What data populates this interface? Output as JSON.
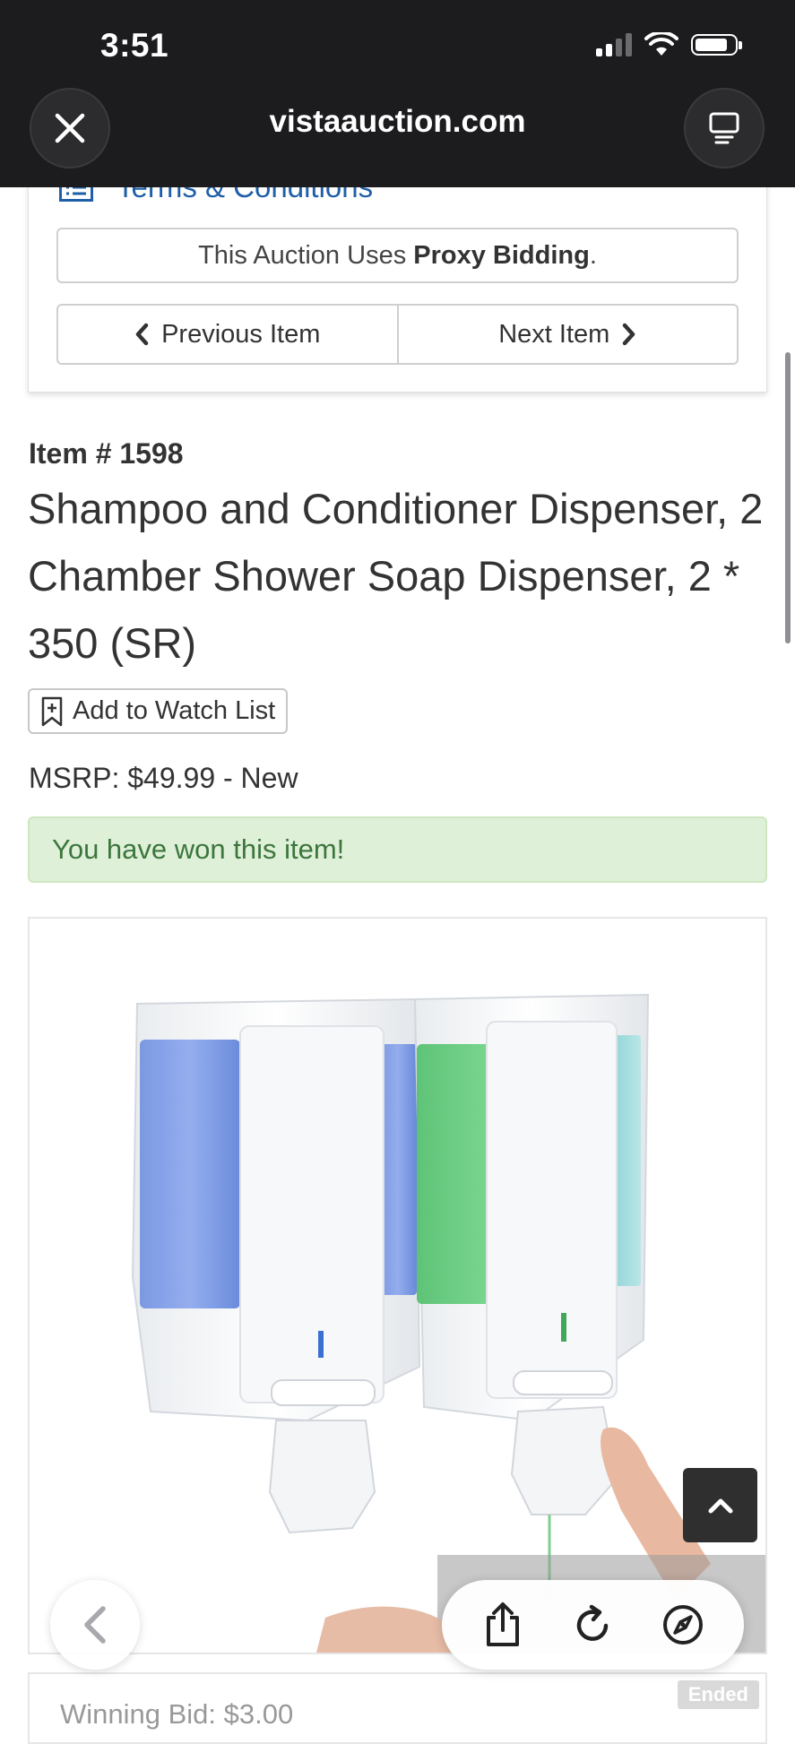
{
  "status_bar": {
    "time": "3:51"
  },
  "browser": {
    "url": "vistaauction.com"
  },
  "card": {
    "terms_label": "Terms & Conditions",
    "proxy_prefix": "This Auction Uses ",
    "proxy_bold": "Proxy Bidding",
    "proxy_suffix": ".",
    "prev_label": "Previous Item",
    "next_label": "Next Item"
  },
  "item": {
    "number": "Item # 1598",
    "title": "Shampoo and Conditioner Dispenser, 2 Chamber Shower Soap Dispenser, 2 * 350 (SR)",
    "watch_label": "Add to Watch List",
    "msrp": "MSRP: $49.99 - New",
    "won_message": "You have won this item!",
    "winning_bid": "Winning Bid: $3.00",
    "status_badge": "Ended"
  },
  "colors": {
    "link": "#1f5fa8",
    "success_bg": "#dff0d8",
    "success_text": "#3c763d",
    "chrome": "#1c1c1e"
  },
  "icons": [
    "close-icon",
    "reader-mode-icon",
    "list-icon",
    "chevron-left-icon",
    "chevron-right-icon",
    "bookmark-plus-icon",
    "chevron-up-icon",
    "back-arrow-icon",
    "share-icon",
    "reload-icon",
    "compass-icon"
  ]
}
